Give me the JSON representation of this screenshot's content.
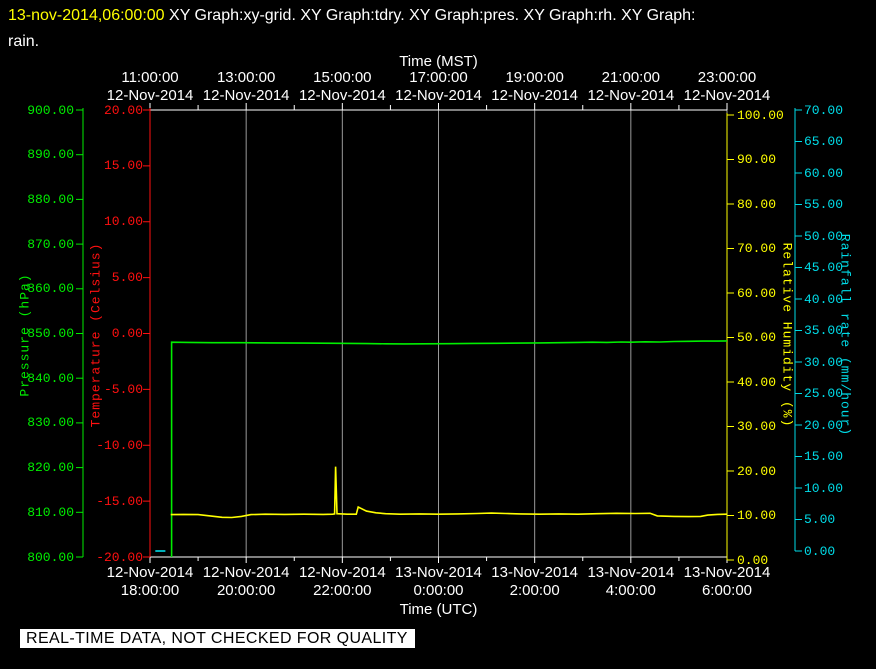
{
  "header": {
    "timestamp": "13-nov-2014,06:00:00",
    "graphs_line1": " XY Graph:xy-grid.  XY Graph:tdry.  XY Graph:pres.  XY Graph:rh.  XY Graph:",
    "graphs_line2": "rain."
  },
  "notice": {
    "text": "REAL-TIME DATA, NOT CHECKED FOR QUALITY"
  },
  "colors": {
    "background": "#000000",
    "pressure": "#00ee00",
    "temperature": "#ff1010",
    "humidity": "#ffff00",
    "rain": "#00dce8",
    "gridline": "#9a9a9a",
    "axis_white": "#ffffff",
    "notice_bg": "#ffffff",
    "notice_text": "#000000",
    "title_stamp": "#ffff00"
  },
  "chart_data": {
    "type": "line",
    "title": "",
    "grid": "vertical gridlines at 2-hour major ticks, minor ticks hourly",
    "top_axis": {
      "label": "Time (MST)",
      "ticks": [
        {
          "time": "11:00:00",
          "date": "12-Nov-2014"
        },
        {
          "time": "13:00:00",
          "date": "12-Nov-2014"
        },
        {
          "time": "15:00:00",
          "date": "12-Nov-2014"
        },
        {
          "time": "17:00:00",
          "date": "12-Nov-2014"
        },
        {
          "time": "19:00:00",
          "date": "12-Nov-2014"
        },
        {
          "time": "21:00:00",
          "date": "12-Nov-2014"
        },
        {
          "time": "23:00:00",
          "date": "12-Nov-2014"
        }
      ]
    },
    "bottom_axis": {
      "label": "Time (UTC)",
      "hours_utc": [
        18,
        20,
        22,
        24,
        26,
        28,
        30
      ],
      "ticks": [
        {
          "date": "12-Nov-2014",
          "time": "18:00:00"
        },
        {
          "date": "12-Nov-2014",
          "time": "20:00:00"
        },
        {
          "date": "12-Nov-2014",
          "time": "22:00:00"
        },
        {
          "date": "13-Nov-2014",
          "time": "0:00:00"
        },
        {
          "date": "13-Nov-2014",
          "time": "2:00:00"
        },
        {
          "date": "13-Nov-2014",
          "time": "4:00:00"
        },
        {
          "date": "13-Nov-2014",
          "time": "6:00:00"
        }
      ]
    },
    "y_axes": [
      {
        "id": "pressure",
        "title": "Pressure (hPa)",
        "color": "#00ee00",
        "min": 800,
        "max": 900,
        "tick_step": 10,
        "side": "left"
      },
      {
        "id": "temperature",
        "title": "Temperature (Celsius)",
        "color": "#ff1010",
        "min": -20,
        "max": 20,
        "tick_step": 5,
        "side": "left"
      },
      {
        "id": "rh",
        "title": "Relative Humidity (%)",
        "color": "#ffff00",
        "min": 0,
        "max": 100,
        "tick_step": 10,
        "side": "right"
      },
      {
        "id": "rain",
        "title": "Rainfall rate (mm/hour)",
        "color": "#00dce8",
        "min": 0,
        "max": 70,
        "tick_step": 5,
        "side": "right"
      }
    ],
    "series": [
      {
        "name": "pres",
        "axis": "pressure",
        "color": "#00ee00",
        "points": [
          [
            18.45,
            800
          ],
          [
            18.45,
            848.05
          ],
          [
            18.8,
            848.0
          ],
          [
            19.3,
            847.95
          ],
          [
            19.9,
            847.95
          ],
          [
            20.5,
            847.9
          ],
          [
            21.2,
            847.85
          ],
          [
            21.9,
            847.8
          ],
          [
            22.5,
            847.75
          ],
          [
            22.9,
            847.7
          ],
          [
            23.3,
            847.68
          ],
          [
            23.7,
            847.7
          ],
          [
            24.2,
            847.72
          ],
          [
            24.7,
            847.78
          ],
          [
            25.2,
            847.8
          ],
          [
            25.7,
            847.85
          ],
          [
            26.1,
            847.9
          ],
          [
            26.5,
            847.95
          ],
          [
            26.9,
            848.0
          ],
          [
            27.2,
            848.05
          ],
          [
            27.5,
            848.0
          ],
          [
            27.8,
            848.1
          ],
          [
            28.0,
            848.05
          ],
          [
            28.3,
            848.15
          ],
          [
            28.6,
            848.1
          ],
          [
            28.9,
            848.2
          ],
          [
            29.2,
            848.25
          ],
          [
            29.5,
            848.3
          ],
          [
            29.8,
            848.3
          ],
          [
            30,
            848.35
          ]
        ]
      },
      {
        "name": "tdry",
        "axis": "temperature",
        "color": "#ff1010",
        "points": []
      },
      {
        "name": "rh",
        "axis": "rh",
        "color": "#ffff00",
        "points": [
          [
            18.43,
            10.2
          ],
          [
            18.7,
            10.25
          ],
          [
            19.0,
            10.2
          ],
          [
            19.25,
            9.9
          ],
          [
            19.5,
            9.6
          ],
          [
            19.7,
            9.55
          ],
          [
            19.9,
            9.8
          ],
          [
            20.1,
            10.2
          ],
          [
            20.4,
            10.3
          ],
          [
            20.8,
            10.25
          ],
          [
            21.2,
            10.3
          ],
          [
            21.6,
            10.25
          ],
          [
            21.8,
            10.3
          ],
          [
            21.84,
            10.35
          ],
          [
            21.86,
            21.0
          ],
          [
            21.89,
            10.4
          ],
          [
            22.1,
            10.3
          ],
          [
            22.29,
            10.3
          ],
          [
            22.33,
            11.9
          ],
          [
            22.5,
            11.0
          ],
          [
            22.7,
            10.6
          ],
          [
            22.9,
            10.4
          ],
          [
            23.2,
            10.3
          ],
          [
            23.6,
            10.35
          ],
          [
            24.0,
            10.3
          ],
          [
            24.4,
            10.35
          ],
          [
            24.8,
            10.45
          ],
          [
            25.1,
            10.55
          ],
          [
            25.4,
            10.45
          ],
          [
            25.7,
            10.35
          ],
          [
            26.1,
            10.3
          ],
          [
            26.5,
            10.35
          ],
          [
            26.9,
            10.3
          ],
          [
            27.3,
            10.4
          ],
          [
            27.7,
            10.5
          ],
          [
            28.1,
            10.45
          ],
          [
            28.4,
            10.5
          ],
          [
            28.55,
            9.9
          ],
          [
            28.9,
            9.8
          ],
          [
            29.2,
            9.75
          ],
          [
            29.45,
            9.8
          ],
          [
            29.6,
            10.1
          ],
          [
            29.8,
            10.25
          ],
          [
            30,
            10.3
          ]
        ]
      },
      {
        "name": "rain",
        "axis": "rain",
        "color": "#00dce8",
        "points": [
          [
            18.11,
            0
          ],
          [
            18.32,
            0
          ]
        ]
      }
    ]
  }
}
